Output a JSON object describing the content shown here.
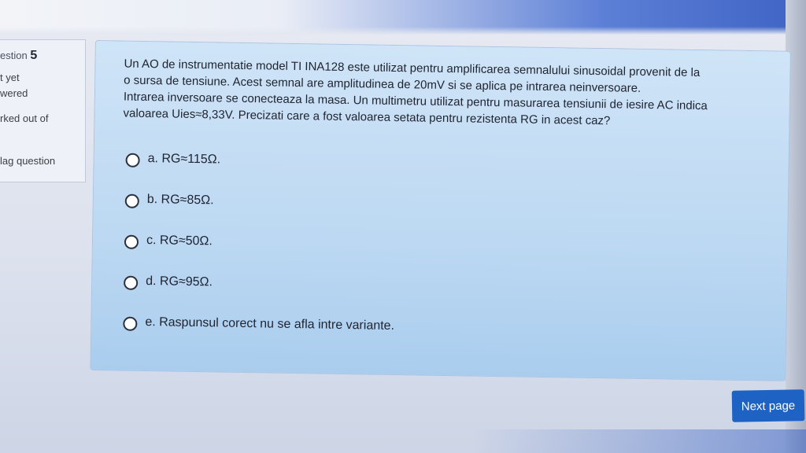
{
  "sidebar": {
    "question_label": "estion",
    "question_number": "5",
    "status_line1": "t yet",
    "status_line2": "wered",
    "marked_label": "rked out of",
    "flag_label": "lag question"
  },
  "question": {
    "lines": [
      "Un AO de instrumentatie model TI INA128 este utilizat pentru amplificarea semnalului sinusoidal provenit de la",
      "o sursa de tensiune. Acest semnal are amplitudinea de 20mV si se aplica pe intrarea neinversoare.",
      "Intrarea inversoare se conecteaza la masa. Un multimetru utilizat pentru masurarea tensiunii de iesire AC indica",
      "valoarea Uies≈8,33V. Precizati care a fost valoarea setata pentru rezistenta RG in acest caz?"
    ],
    "answers": [
      "a. RG≈115Ω.",
      "b. RG≈85Ω.",
      "c. RG≈50Ω.",
      "d. RG≈95Ω.",
      "e. Raspunsul corect nu se afla intre variante."
    ]
  },
  "navigation": {
    "next_label": "Next page"
  },
  "colors": {
    "card_background": "#bcd8f2",
    "next_button": "#1e63c4"
  }
}
